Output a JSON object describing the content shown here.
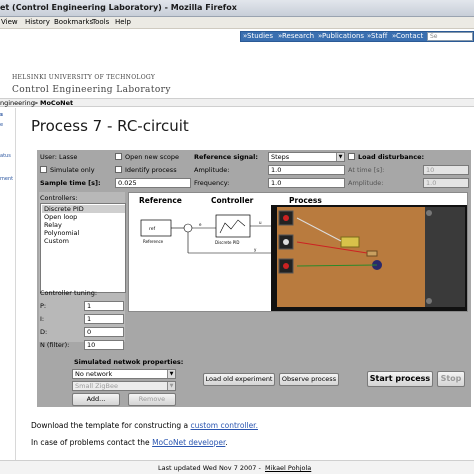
{
  "window": {
    "title": "et (Control Engineering Laboratory) - Mozilla Firefox"
  },
  "menu": {
    "items": [
      "View",
      "History",
      "Bookmarks",
      "Tools",
      "Help"
    ]
  },
  "nav": {
    "items": [
      "Studies",
      "Research",
      "Publications",
      "Staff",
      "Contact"
    ],
    "search_placeholder": "Se"
  },
  "header": {
    "university": "HELSINKI UNIVERSITY OF TECHNOLOGY",
    "lab": "Control Engineering Laboratory"
  },
  "breadcrumb": {
    "parent": "ngineering",
    "sep": ">",
    "current": "MoCoNet"
  },
  "sidebar": {
    "items": [
      "s",
      "e",
      "atus",
      "ment"
    ]
  },
  "page": {
    "title": "Process 7 - RC-circuit"
  },
  "panel": {
    "user": "User: Lasse",
    "open_new_scope": "Open new scope",
    "simulate_only": "Simulate only",
    "identify_process": "Identify process",
    "sample_time_label": "Sample time [s]:",
    "sample_time_value": "0.025",
    "reference_signal_label": "Reference signal:",
    "reference_signal_value": "Steps",
    "amplitude_label": "Amplitude:",
    "amplitude_value": "1.0",
    "frequency_label": "Frequency:",
    "frequency_value": "1.0",
    "load_disturbance_label": "Load disturbance:",
    "at_time_label": "At time [s]:",
    "at_time_value": "10",
    "load_amplitude_label": "Amplitude:",
    "load_amplitude_value": "1.0",
    "controllers_label": "Controllers:",
    "controllers": [
      "Discrete PID",
      "Open loop",
      "Relay",
      "Polynomial",
      "Custom"
    ],
    "controllers_selected": 0,
    "tuning_label": "Controller tuning:",
    "tuning": [
      {
        "label": "P:",
        "value": "1"
      },
      {
        "label": "I:",
        "value": "1"
      },
      {
        "label": "D:",
        "value": "0"
      },
      {
        "label": "N (filter):",
        "value": "10"
      }
    ],
    "network_label": "Simulated netwok properties:",
    "network_value": "No network",
    "network_option2": "Small ZigBee",
    "add_button": "Add...",
    "remove_button": "Remove",
    "load_old_button": "Load old experiment",
    "observe_button": "Observe process",
    "start_button": "Start process",
    "stop_button": "Stop"
  },
  "diagram": {
    "reference_title": "Reference",
    "controller_title": "Controller",
    "process_title": "Process",
    "ref_block": "ref",
    "reference_caption": "Reference",
    "pid_caption": "Discrete PID",
    "e_label": "e",
    "u_label": "u",
    "y_label": "y"
  },
  "footer": {
    "line1_prefix": "Download the template for constructing a ",
    "line1_link": "custom controller.",
    "line2_prefix": "In case of problems contact the ",
    "line2_link": "MoCoNet developer",
    "line2_suffix": ".",
    "last_updated": "Last updated Wed Nov 7 2007 - ",
    "author": "Mikael Pohjola"
  },
  "colors": {
    "nav_blue": "#3a6fb0",
    "panel_gray": "#a7a7a7",
    "link_blue": "#2a55b0"
  }
}
